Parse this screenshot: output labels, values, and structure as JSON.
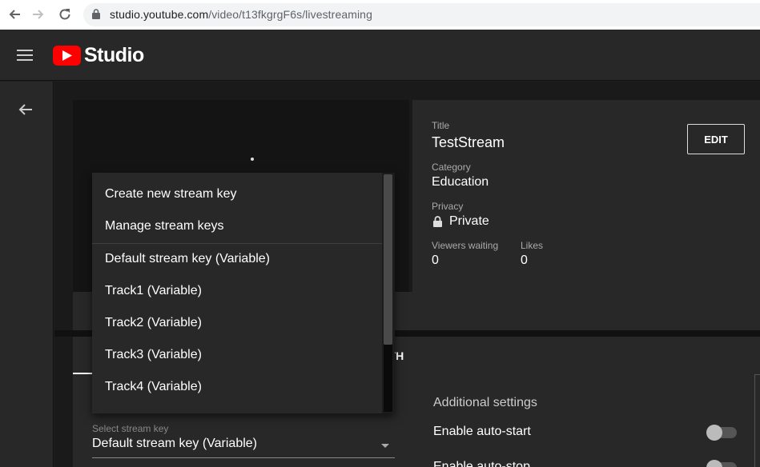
{
  "browser": {
    "url_host": "studio.youtube.com",
    "url_path": "/video/t13fkgrgF6s/livestreaming"
  },
  "header": {
    "logo_text": "Studio"
  },
  "stream_info": {
    "title_label": "Title",
    "title_value": "TestStream",
    "category_label": "Category",
    "category_value": "Education",
    "privacy_label": "Privacy",
    "privacy_value": "Private",
    "viewers_label": "Viewers waiting",
    "viewers_value": "0",
    "likes_label": "Likes",
    "likes_value": "0",
    "edit_label": "EDIT"
  },
  "tabs": {
    "partial_tab_label": "LTH"
  },
  "additional_settings": {
    "title": "Additional settings",
    "autostart_label": "Enable auto-start",
    "autostart_on": false,
    "next_label_partial": "Enable auto-stop"
  },
  "stream_key_select": {
    "label": "Select stream key",
    "value": "Default stream key (Variable)"
  },
  "dropdown": {
    "items": [
      "Create new stream key",
      "Manage stream keys",
      "Default stream key (Variable)",
      "Track1 (Variable)",
      "Track2 (Variable)",
      "Track3 (Variable)",
      "Track4 (Variable)"
    ]
  }
}
